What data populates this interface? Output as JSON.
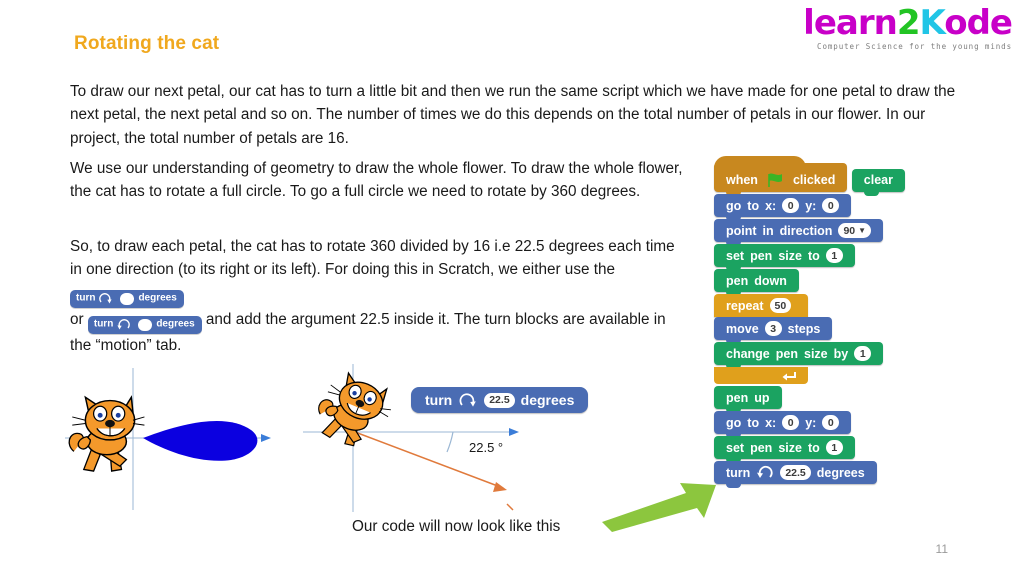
{
  "logo": {
    "part1": "learn",
    "part2": "2",
    "part3": "K",
    "part4": "ode",
    "tagline": "Computer Science for the young minds",
    "colors": {
      "magenta": "#c800c8",
      "green": "#22c424",
      "cyan": "#21c5e6"
    }
  },
  "title": "Rotating the cat",
  "title_color": "#f0a81e",
  "paragraphs": {
    "p1": "To draw our next petal, our cat has to turn a little bit and then we run the same script which we have made for one petal to draw the next petal, the next petal and so on. The number of times we do this depends on the total number of petals in our flower. In our project, the total number of petals are 16.",
    "p2": "We use our understanding of geometry to draw the whole flower. To draw the whole flower, the cat has to rotate a full circle. To go a full circle we need to rotate by 360 degrees.",
    "p3_a": "So, to draw each petal, the cat has to rotate 360 divided by 16 i.e 22.5 degrees each time in one direction (to its right or its left). For doing this in Scratch, we either use the",
    "p3_b": "or",
    "p3_c": "and add the argument 22.5 inside it. The turn blocks are available in the “motion” tab."
  },
  "inline_blocks": [
    {
      "label": "turn",
      "direction": "clockwise",
      "value": "",
      "unit": "degrees"
    },
    {
      "label": "turn",
      "direction": "counter-clockwise",
      "value": "",
      "unit": "degrees"
    }
  ],
  "illustration": {
    "turn_block": {
      "label": "turn",
      "direction": "clockwise",
      "value": "22.5",
      "unit": "degrees"
    },
    "angle_label": "22.5 °",
    "petal_color": "#0b00e0",
    "angle_line_color": "#e07a3c",
    "cat_color": "#f4992b"
  },
  "caption": "Our code will now look like this",
  "arrow_color": "#8cc63e",
  "page_number": "11",
  "script_colors": {
    "motion": "#4a6cb3",
    "pen": "#1ba361",
    "control": "#e0a01c",
    "events": "#c8881f"
  },
  "script": {
    "b0": {
      "w1": "when",
      "icon": "green-flag",
      "w2": "clicked"
    },
    "b1": {
      "w1": "clear"
    },
    "b2": {
      "w1": "go",
      "w2": "to",
      "w3": "x:",
      "x": "0",
      "w4": "y:",
      "y": "0"
    },
    "b3": {
      "w1": "point",
      "w2": "in",
      "w3": "direction",
      "value": "90"
    },
    "b4": {
      "w1": "set",
      "w2": "pen",
      "w3": "size",
      "w4": "to",
      "value": "1"
    },
    "b5": {
      "w1": "pen",
      "w2": "down"
    },
    "b6": {
      "w1": "repeat",
      "value": "50"
    },
    "b7": {
      "w1": "move",
      "value": "3",
      "w2": "steps"
    },
    "b8": {
      "w1": "change",
      "w2": "pen",
      "w3": "size",
      "w4": "by",
      "value": "1"
    },
    "b9": {
      "w1": "pen",
      "w2": "up"
    },
    "b10": {
      "w1": "go",
      "w2": "to",
      "w3": "x:",
      "x": "0",
      "w4": "y:",
      "y": "0"
    },
    "b11": {
      "w1": "set",
      "w2": "pen",
      "w3": "size",
      "w4": "to",
      "value": "1"
    },
    "b12": {
      "w1": "turn",
      "direction": "counter-clockwise",
      "value": "22.5",
      "w2": "degrees"
    }
  }
}
